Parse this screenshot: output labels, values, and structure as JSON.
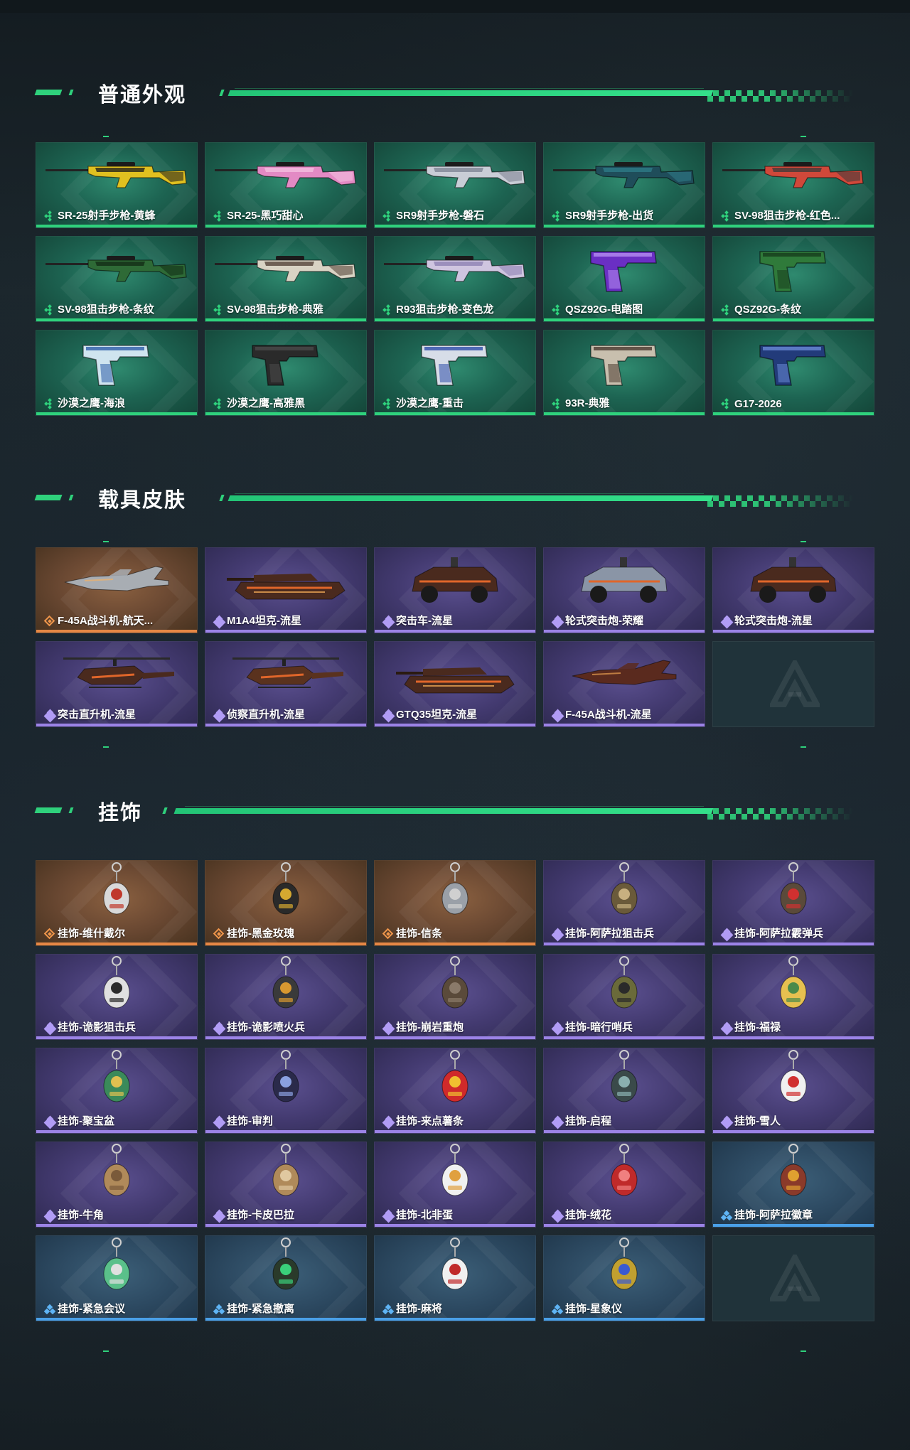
{
  "sections": [
    {
      "title": "普通外观",
      "items": [
        {
          "label": "SR-25射手步枪-黄蜂",
          "rarity": "green",
          "icon": "rifle-yellow-camo"
        },
        {
          "label": "SR-25-黑巧甜心",
          "rarity": "green",
          "icon": "rifle-pink-camo"
        },
        {
          "label": "SR9射手步枪-磐石",
          "rarity": "green",
          "icon": "rifle-white-camo"
        },
        {
          "label": "SR9射手步枪-出货",
          "rarity": "green",
          "icon": "rifle-teal"
        },
        {
          "label": "SV-98狙击步枪-红色...",
          "rarity": "green",
          "icon": "sniper-red"
        },
        {
          "label": "SV-98狙击步枪-条纹",
          "rarity": "green",
          "icon": "sniper-green-stripes"
        },
        {
          "label": "SV-98狙击步枪-典雅",
          "rarity": "green",
          "icon": "sniper-cream"
        },
        {
          "label": "R93狙击步枪-变色龙",
          "rarity": "green",
          "icon": "sniper-chameleon"
        },
        {
          "label": "QSZ92G-电踏图",
          "rarity": "green",
          "icon": "pistol-purple"
        },
        {
          "label": "QSZ92G-条纹",
          "rarity": "green",
          "icon": "pistol-green"
        },
        {
          "label": "沙漠之鹰-海浪",
          "rarity": "green",
          "icon": "pistol-wave"
        },
        {
          "label": "沙漠之鹰-高雅黑",
          "rarity": "green",
          "icon": "pistol-black"
        },
        {
          "label": "沙漠之鹰-重击",
          "rarity": "green",
          "icon": "pistol-blue-white"
        },
        {
          "label": "93R-典雅",
          "rarity": "green",
          "icon": "pistol-cream"
        },
        {
          "label": "G17-2026",
          "rarity": "green",
          "icon": "pistol-blue-stars"
        }
      ]
    },
    {
      "title": "载具皮肤",
      "items": [
        {
          "label": "F-45A战斗机-航天...",
          "rarity": "orange",
          "icon": "jet-silver"
        },
        {
          "label": "M1A4坦克-流星",
          "rarity": "purple",
          "icon": "tank-meteor"
        },
        {
          "label": "突击车-流星",
          "rarity": "purple",
          "icon": "assault-car-meteor"
        },
        {
          "label": "轮式突击炮-荣耀",
          "rarity": "purple",
          "icon": "wheeled-gun-glory"
        },
        {
          "label": "轮式突击炮-流星",
          "rarity": "purple",
          "icon": "wheeled-gun-meteor"
        },
        {
          "label": "突击直升机-流星",
          "rarity": "purple",
          "icon": "attack-helicopter-meteor"
        },
        {
          "label": "侦察直升机-流星",
          "rarity": "purple",
          "icon": "scout-helicopter-meteor"
        },
        {
          "label": "GTQ35坦克-流星",
          "rarity": "purple",
          "icon": "tank-meteor-2"
        },
        {
          "label": "F-45A战斗机-流星",
          "rarity": "purple",
          "icon": "jet-meteor"
        },
        {
          "label": "",
          "rarity": "empty",
          "icon": "empty-slot-logo"
        }
      ]
    },
    {
      "title": "挂饰",
      "items": [
        {
          "label": "挂饰-维什戴尔",
          "rarity": "orange",
          "icon": "charm-card"
        },
        {
          "label": "挂饰-黑金玫瑰",
          "rarity": "orange",
          "icon": "charm-rose"
        },
        {
          "label": "挂饰-信条",
          "rarity": "orange",
          "icon": "charm-creed"
        },
        {
          "label": "挂饰-阿萨拉狙击兵",
          "rarity": "purple",
          "icon": "charm-sniper"
        },
        {
          "label": "挂饰-阿萨拉霰弹兵",
          "rarity": "purple",
          "icon": "charm-shotgunner"
        },
        {
          "label": "挂饰-诡影狙击兵",
          "rarity": "purple",
          "icon": "charm-shadow-sniper"
        },
        {
          "label": "挂饰-诡影喷火兵",
          "rarity": "purple",
          "icon": "charm-flamer"
        },
        {
          "label": "挂饰-崩岩重炮",
          "rarity": "purple",
          "icon": "charm-heavy"
        },
        {
          "label": "挂饰-暗行哨兵",
          "rarity": "purple",
          "icon": "charm-sentry"
        },
        {
          "label": "挂饰-福禄",
          "rarity": "purple",
          "icon": "charm-gourd"
        },
        {
          "label": "挂饰-聚宝盆",
          "rarity": "purple",
          "icon": "charm-treasure"
        },
        {
          "label": "挂饰-审判",
          "rarity": "purple",
          "icon": "charm-judge"
        },
        {
          "label": "挂饰-来点薯条",
          "rarity": "purple",
          "icon": "charm-fries"
        },
        {
          "label": "挂饰-启程",
          "rarity": "purple",
          "icon": "charm-start"
        },
        {
          "label": "挂饰-雪人",
          "rarity": "purple",
          "icon": "charm-snowman"
        },
        {
          "label": "挂饰-牛角",
          "rarity": "purple",
          "icon": "charm-horns"
        },
        {
          "label": "挂饰-卡皮巴拉",
          "rarity": "purple",
          "icon": "charm-capybara"
        },
        {
          "label": "挂饰-北非蛋",
          "rarity": "purple",
          "icon": "charm-egg"
        },
        {
          "label": "挂饰-绒花",
          "rarity": "purple",
          "icon": "charm-flower"
        },
        {
          "label": "挂饰-阿萨拉徽章",
          "rarity": "blue",
          "icon": "charm-badge"
        },
        {
          "label": "挂饰-紧急会议",
          "rarity": "blue",
          "icon": "charm-meeting"
        },
        {
          "label": "挂饰-紧急撤离",
          "rarity": "blue",
          "icon": "charm-evac"
        },
        {
          "label": "挂饰-麻将",
          "rarity": "blue",
          "icon": "charm-mahjong"
        },
        {
          "label": "挂饰-星象仪",
          "rarity": "blue",
          "icon": "charm-orrery"
        },
        {
          "label": "",
          "rarity": "empty",
          "icon": "empty-slot-logo"
        }
      ]
    }
  ]
}
